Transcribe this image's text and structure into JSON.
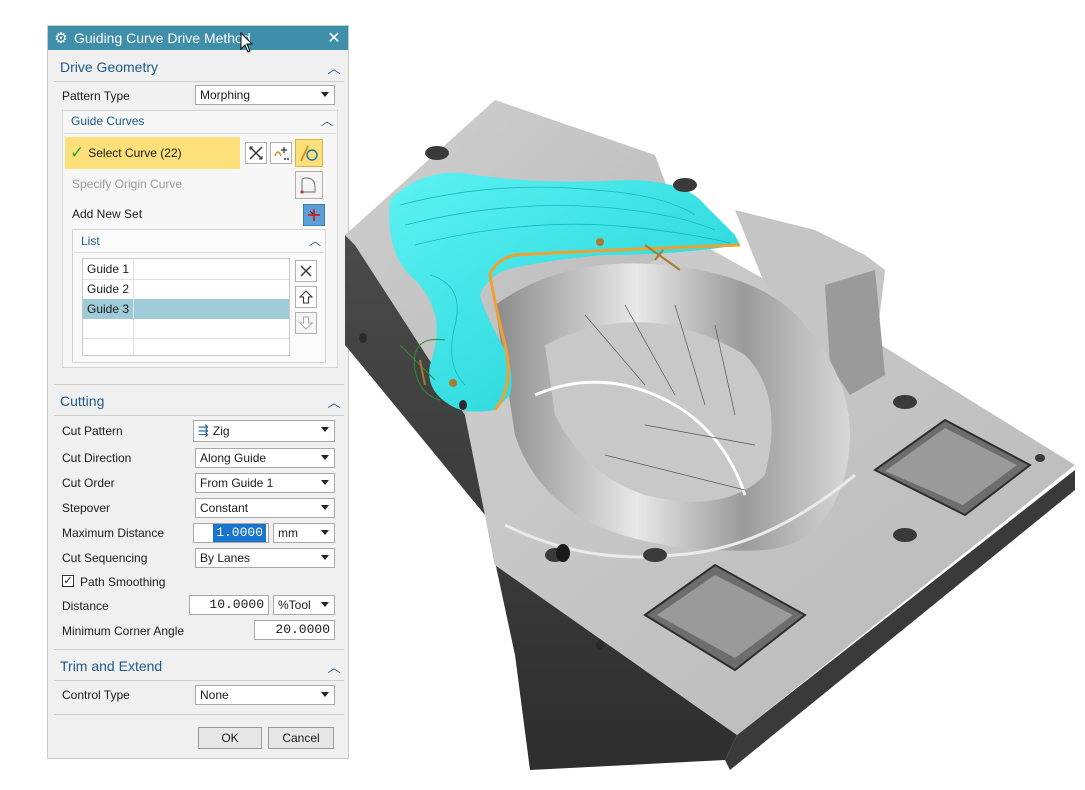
{
  "dialog": {
    "title": "Guiding Curve Drive Method"
  },
  "drive_geometry": {
    "header": "Drive Geometry",
    "pattern_type_label": "Pattern Type",
    "pattern_type_value": "Morphing",
    "guide_curves": {
      "header": "Guide Curves",
      "select_curve_label": "Select Curve (22)",
      "specify_origin_label": "Specify Origin Curve",
      "add_new_set_label": "Add New Set",
      "list": {
        "header": "List",
        "items": [
          "Guide  1",
          "Guide  2",
          "Guide  3"
        ],
        "selected_index": 2
      }
    }
  },
  "cutting": {
    "header": "Cutting",
    "cut_pattern_label": "Cut Pattern",
    "cut_pattern_value": "Zig",
    "cut_direction_label": "Cut Direction",
    "cut_direction_value": "Along Guide",
    "cut_order_label": "Cut Order",
    "cut_order_value": "From Guide 1",
    "stepover_label": "Stepover",
    "stepover_value": "Constant",
    "max_distance_label": "Maximum Distance",
    "max_distance_value": "1.0000",
    "max_distance_unit": "mm",
    "cut_sequencing_label": "Cut Sequencing",
    "cut_sequencing_value": "By Lanes",
    "path_smoothing_label": "Path Smoothing",
    "path_smoothing_checked": true,
    "distance_label": "Distance",
    "distance_value": "10.0000",
    "distance_unit": "%Tool",
    "min_corner_angle_label": "Minimum Corner Angle",
    "min_corner_angle_value": "20.0000"
  },
  "trim_extend": {
    "header": "Trim and Extend",
    "control_type_label": "Control Type",
    "control_type_value": "None"
  },
  "footer": {
    "ok_label": "OK",
    "cancel_label": "Cancel"
  },
  "colors": {
    "titlebar": "#3f8eaa",
    "section_header": "#1f5b8c",
    "selection_highlight": "#fde07a",
    "list_selected": "#9fcbd9",
    "toolpath": "#2ee0e0",
    "guide_curve": "#f0a030",
    "part_metal": "#a9a9a9"
  }
}
